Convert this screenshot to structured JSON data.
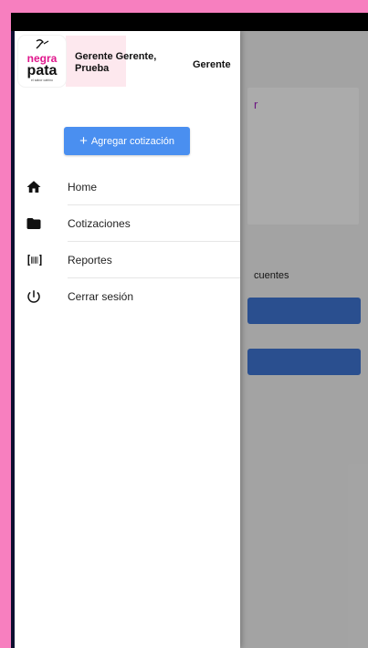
{
  "background_app": {
    "card_char": "r",
    "text": "cuentes"
  },
  "drawer": {
    "logo": {
      "line1": "negra",
      "line2": "pata",
      "tagline": "el sabor catrino"
    },
    "user_name": "Gerente Gerente, Prueba",
    "user_role": "Gerente",
    "add_button_label": "Agregar cotización",
    "items": [
      {
        "label": "Home",
        "icon": "home-icon"
      },
      {
        "label": "Cotizaciones",
        "icon": "folder-icon"
      },
      {
        "label": "Reportes",
        "icon": "barcode-icon"
      },
      {
        "label": "Cerrar sesión",
        "icon": "power-icon"
      }
    ]
  },
  "colors": {
    "page_background": "#f77fbf",
    "primary_button": "#4a8ff0",
    "background_button": "#3f76d6",
    "logo_pink": "#e0168c"
  }
}
